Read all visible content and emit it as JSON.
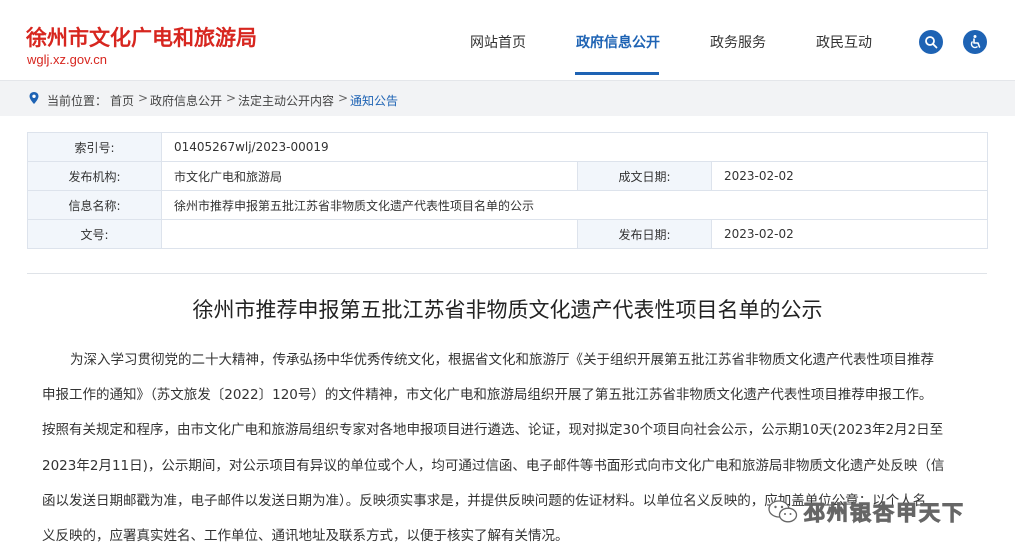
{
  "header": {
    "site_title": "徐州市文化广电和旅游局",
    "site_domain": "wglj.xz.gov.cn",
    "nav": [
      {
        "label": "网站首页",
        "active": false
      },
      {
        "label": "政府信息公开",
        "active": true
      },
      {
        "label": "政务服务",
        "active": false
      },
      {
        "label": "政民互动",
        "active": false
      }
    ],
    "search_icon": "search-icon",
    "accessibility_icon": "accessibility-icon",
    "accent_color": "#1e63b4",
    "brand_color": "#d7261f"
  },
  "breadcrumb": {
    "prefix": "当前位置：",
    "items": [
      "首页",
      "政府信息公开",
      "法定主动公开内容",
      "通知公告"
    ],
    "separator": ">"
  },
  "info": {
    "index_label": "索引号:",
    "index_value": "01405267wlj/2023-00019",
    "publisher_label": "发布机构:",
    "publisher_value": "市文化广电和旅游局",
    "created_label": "成文日期:",
    "created_value": "2023-02-02",
    "name_label": "信息名称:",
    "name_value": "徐州市推荐申报第五批江苏省非物质文化遗产代表性项目名单的公示",
    "docno_label": "文号:",
    "docno_value": "",
    "published_label": "发布日期:",
    "published_value": "2023-02-02"
  },
  "article": {
    "title": "徐州市推荐申报第五批江苏省非物质文化遗产代表性项目名单的公示",
    "lines": [
      "为深入学习贯彻党的二十大精神，传承弘扬中华优秀传统文化，根据省文化和旅游厅《关于组织开展第五批江苏省非物质文化遗产代表性项目推荐",
      "申报工作的通知》（苏文旅发〔2022〕120号）的文件精神，市文化广电和旅游局组织开展了第五批江苏省非物质文化遗产代表性项目推荐申报工作。",
      "按照有关规定和程序，由市文化广电和旅游局组织专家对各地申报项目进行遴选、论证，现对拟定30个项目向社会公示，公示期10天(2023年2月2日至",
      "2023年2月11日)，公示期间，对公示项目有异议的单位或个人，均可通过信函、电子邮件等书面形式向市文化广电和旅游局非物质文化遗产处反映（信",
      "函以发送日期邮戳为准，电子邮件以发送日期为准）。反映须实事求是，并提供反映问题的佐证材料。以单位名义反映的，应加盖单位公章；以个人名",
      "义反映的，应署真实姓名、工作单位、通讯地址及联系方式，以便于核实了解有关情况。"
    ]
  },
  "watermark": {
    "text": "邳州银杏甲天下",
    "icon": "wechat-icon"
  }
}
